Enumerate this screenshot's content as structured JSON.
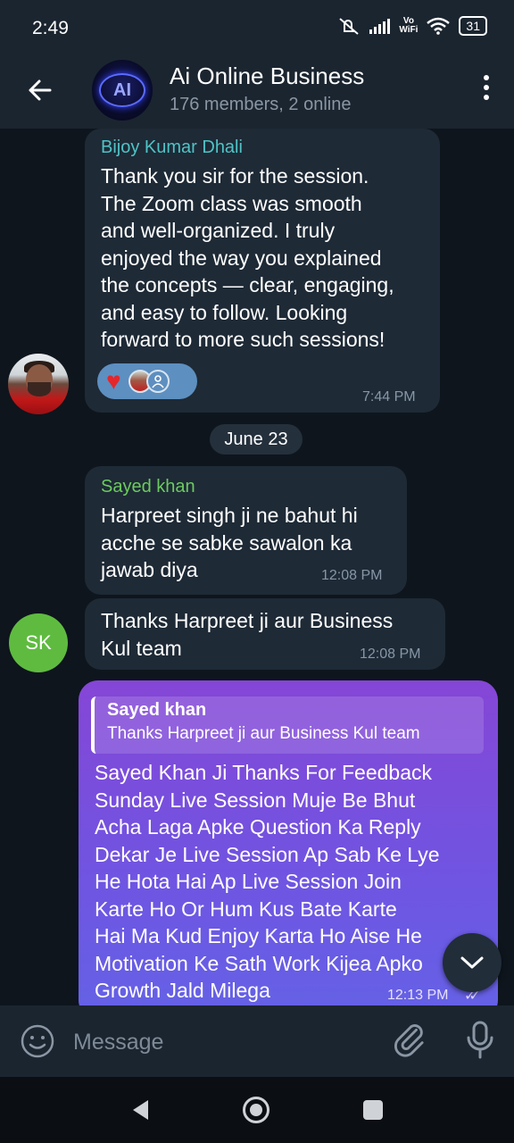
{
  "status_bar": {
    "time": "2:49",
    "vowifi_top": "Vo",
    "vowifi_bottom": "WiFi",
    "battery": "31"
  },
  "header": {
    "title": "Ai Online Business",
    "subtitle": "176 members, 2 online",
    "avatar_text": "AI"
  },
  "messages": [
    {
      "sender": "Bijoy Kumar Dhali",
      "sender_color": "#4fc3c6",
      "text": "Thank you sir for the session.\nThe Zoom class was smooth\nand well-organized. I truly\nenjoyed the way you explained\nthe concepts — clear, engaging,\nand easy to follow. Looking\nforward to more such sessions!",
      "time": "7:44 PM",
      "reaction": "heart"
    },
    {
      "sender": "Sayed khan",
      "sender_color": "#6ccb5f",
      "text": "Harpreet singh ji ne bahut hi\nacche se sabke sawalon ka\njawab diya",
      "time": "12:08 PM"
    },
    {
      "text": "Thanks Harpreet ji aur Business\nKul team",
      "time": "12:08 PM",
      "avatar_initials": "SK"
    },
    {
      "reply_to_name": "Sayed khan",
      "reply_to_text": "Thanks Harpreet ji aur Business Kul team",
      "text": "Sayed Khan Ji Thanks For Feedback\nSunday Live Session Muje Be Bhut\nAcha Laga Apke Question Ka Reply\nDekar Je Live Session Ap Sab Ke Lye\nHe Hota Hai Ap Live Session Join\nKarte Ho Or Hum Kus Bate Karte\nHai Ma Kud Enjoy Karta Ho Aise He\nMotivation Ke Sath Work Kijea Apko\nGrowth Jald Milega",
      "time": "12:13 PM",
      "own": true
    }
  ],
  "date_separator": "June 23",
  "composer": {
    "placeholder": "Message"
  },
  "colors": {
    "background": "#0e151d",
    "header": "#1b2530",
    "incoming_bubble": "#1e2a36",
    "outgoing_bubble_top": "#8546d6",
    "outgoing_bubble_bottom": "#6462e6"
  }
}
